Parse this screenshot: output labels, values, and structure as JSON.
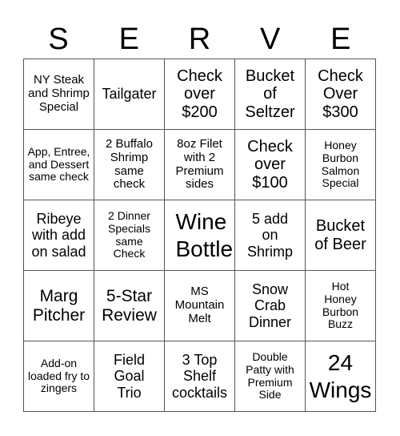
{
  "card": {
    "header_letters": [
      "S",
      "E",
      "R",
      "V",
      "E"
    ],
    "cells": [
      "NY Steak and Shrimp Special",
      "Tailgater",
      "Check over $200",
      "Bucket of Seltzer",
      "Check Over $300",
      "App, Entree, and Dessert same check",
      "2 Buffalo Shrimp same check",
      "8oz Filet with 2 Premium sides",
      "Check over $100",
      "Honey Burbon Salmon Special",
      "Ribeye with add on salad",
      "2 Dinner Specials same Check",
      "Wine Bottle",
      "5 add on Shrimp",
      "Bucket of Beer",
      "Marg Pitcher",
      "5-Star Review",
      "MS Mountain Melt",
      "Snow Crab Dinner",
      "Hot Honey Burbon Buzz",
      "Add-on loaded fry to zingers",
      "Field Goal Trio",
      "3 Top Shelf cocktails",
      "Double Patty with Premium Side",
      "24 Wings"
    ]
  }
}
